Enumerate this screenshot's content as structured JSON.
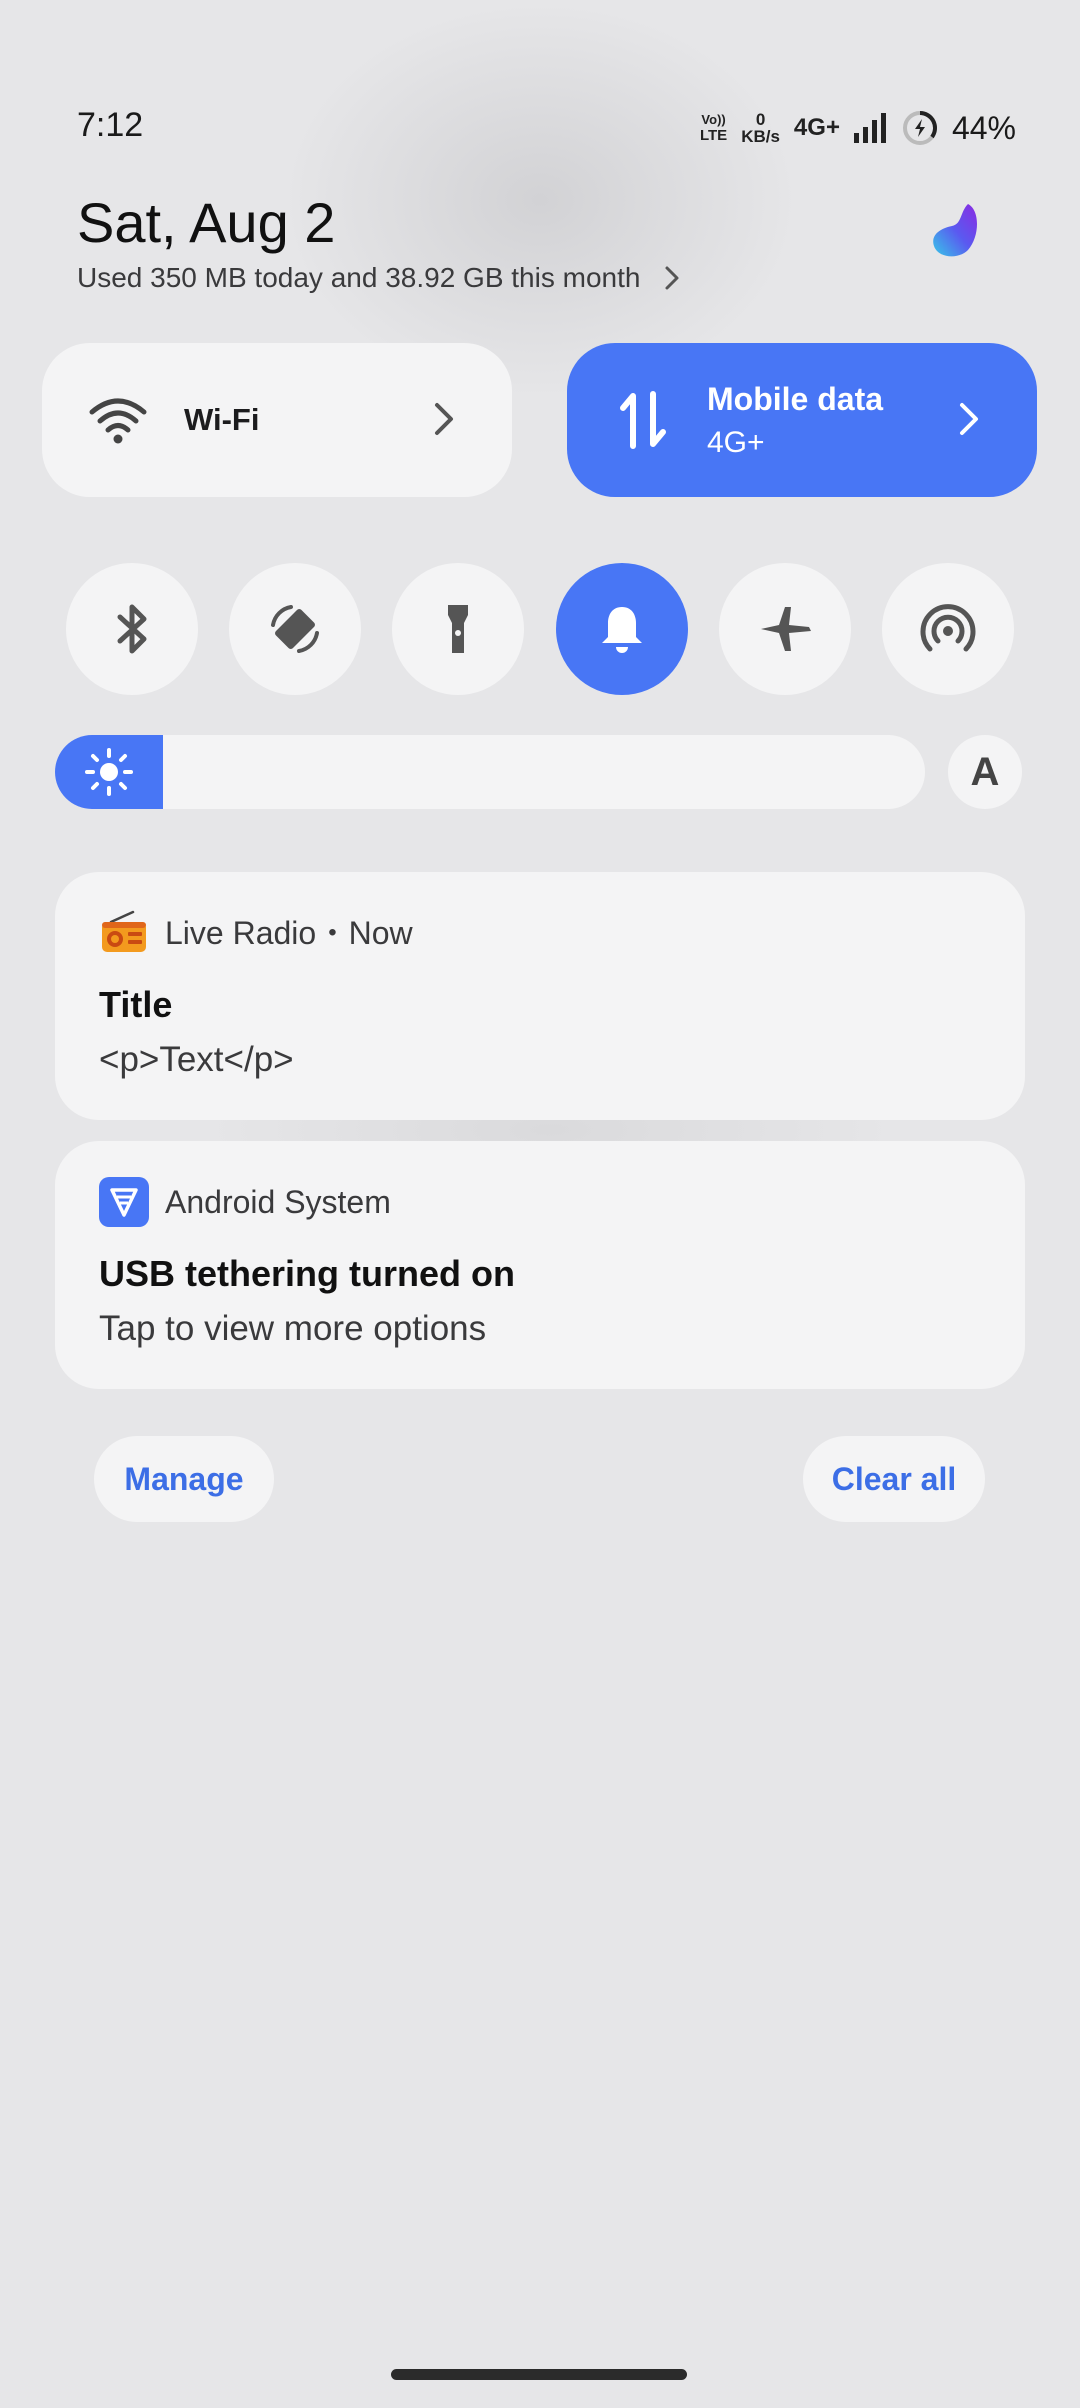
{
  "status_bar": {
    "time": "7:12",
    "volte_top": "Vo))",
    "volte_bottom": "LTE",
    "speed_value": "0",
    "speed_unit": "KB/s",
    "network": "4G+",
    "battery": "44%"
  },
  "header": {
    "date": "Sat, Aug 2",
    "usage": "Used 350 MB today and 38.92 GB this month"
  },
  "tiles": {
    "wifi_label": "Wi-Fi",
    "mobile_label": "Mobile data",
    "mobile_sub": "4G+"
  },
  "toggles": [
    "bluetooth-icon",
    "auto-rotate-icon",
    "flashlight-icon",
    "bell-icon",
    "airplane-icon",
    "hotspot-icon"
  ],
  "brightness": {
    "level": 0.08,
    "auto_label": "A"
  },
  "notifications": [
    {
      "app": "Live Radio",
      "time": "Now",
      "title": "Title",
      "text": "<p>Text</p>"
    },
    {
      "app": "Android System",
      "title": "USB tethering turned on",
      "text": "Tap to view more options"
    }
  ],
  "actions": {
    "manage": "Manage",
    "clear_all": "Clear all"
  },
  "colors": {
    "accent": "#4876f5",
    "tile_bg": "#f4f4f5",
    "background": "#e6e6e8",
    "link": "#3c6ee6"
  }
}
